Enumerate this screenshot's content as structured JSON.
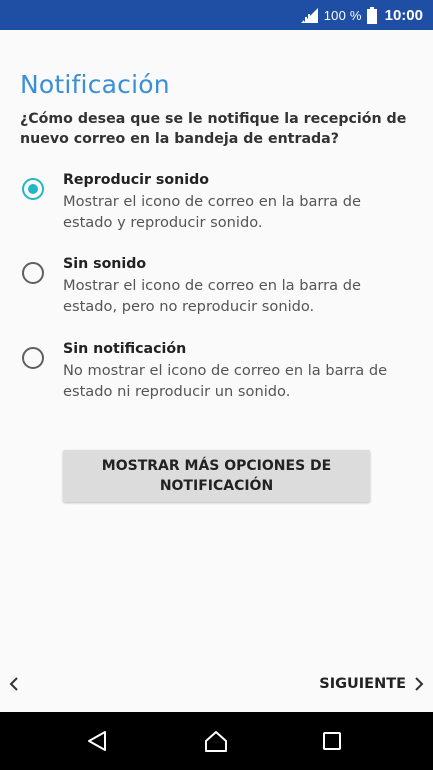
{
  "status_bar": {
    "battery_percent": "100 %",
    "time": "10:00",
    "icons": [
      "signal-icon",
      "battery-icon"
    ]
  },
  "content": {
    "title": "Notificación",
    "question": "¿Cómo desea que se le notifique la recepción de nuevo correo en la bandeja de entrada?",
    "options": [
      {
        "label": "Reproducir sonido",
        "description": "Mostrar el icono de correo en la barra de estado y reproducir sonido.",
        "selected": true
      },
      {
        "label": "Sin sonido",
        "description": "Mostrar el icono de correo en la barra de estado, pero no reproducir sonido.",
        "selected": false
      },
      {
        "label": "Sin notificación",
        "description": "No mostrar el icono de correo en la barra de estado ni reproducir un sonido.",
        "selected": false
      }
    ],
    "more_options_button": "MOSTRAR MÁS OPCIONES DE NOTIFICACIÓN"
  },
  "footer": {
    "next_label": "SIGUIENTE"
  },
  "nav_bar": {
    "buttons": [
      "back-triangle-icon",
      "home-icon",
      "recents-icon"
    ]
  },
  "colors": {
    "status_bar": "#1f4fa5",
    "title": "#3a8fd8",
    "radio_selected": "#23b6c8",
    "background": "#fafafa",
    "button": "#dcdcdc",
    "nav_bar": "#000000"
  }
}
